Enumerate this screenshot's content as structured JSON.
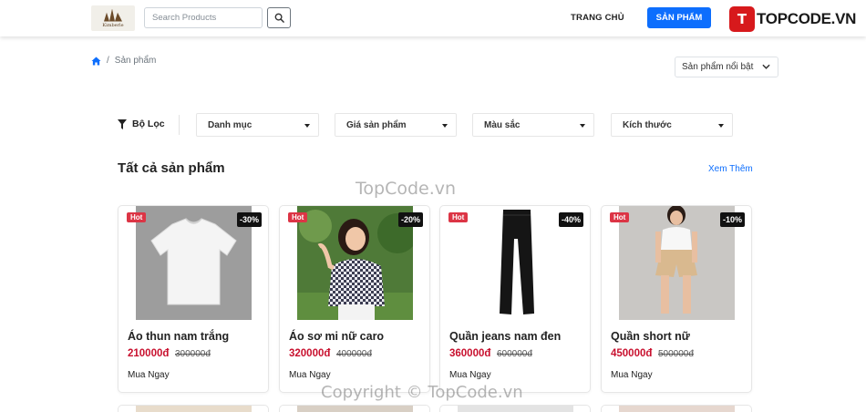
{
  "header": {
    "search_placeholder": "Search Products",
    "nav_home": "TRANG CHỦ",
    "nav_products": "SẢN PHẨM",
    "logo_text": "Kimberle",
    "brand_badge": "T",
    "brand_text": "TOPCODE.VN"
  },
  "breadcrumb": {
    "current": "Sản phẩm"
  },
  "sort": {
    "selected": "Sản phẩm nổi bật"
  },
  "filters": {
    "label": "Bộ Lọc",
    "dropdowns": [
      "Danh mục",
      "Giá sản phẩm",
      "Màu sắc",
      "Kích thước"
    ]
  },
  "section": {
    "title": "Tất cả sản phẩm",
    "see_more": "Xem Thêm"
  },
  "products": [
    {
      "badge": "Hot",
      "discount": "-30%",
      "name": "Áo thun nam trắng",
      "price": "210000đ",
      "old_price": "300000đ",
      "buy": "Mua Ngay"
    },
    {
      "badge": "Hot",
      "discount": "-20%",
      "name": "Áo sơ mi nữ caro",
      "price": "320000đ",
      "old_price": "400000đ",
      "buy": "Mua Ngay"
    },
    {
      "badge": "Hot",
      "discount": "-40%",
      "name": "Quần jeans nam đen",
      "price": "360000đ",
      "old_price": "600000đ",
      "buy": "Mua Ngay"
    },
    {
      "badge": "Hot",
      "discount": "-10%",
      "name": "Quần short nữ",
      "price": "450000đ",
      "old_price": "500000đ",
      "buy": "Mua Ngay"
    }
  ],
  "watermarks": {
    "center": "TopCode.vn",
    "bottom": "Copyright © TopCode.vn"
  },
  "colors": {
    "primary": "#0d6efd",
    "price": "#c8102e",
    "hot": "#dc3545",
    "brand": "#d7191c"
  }
}
